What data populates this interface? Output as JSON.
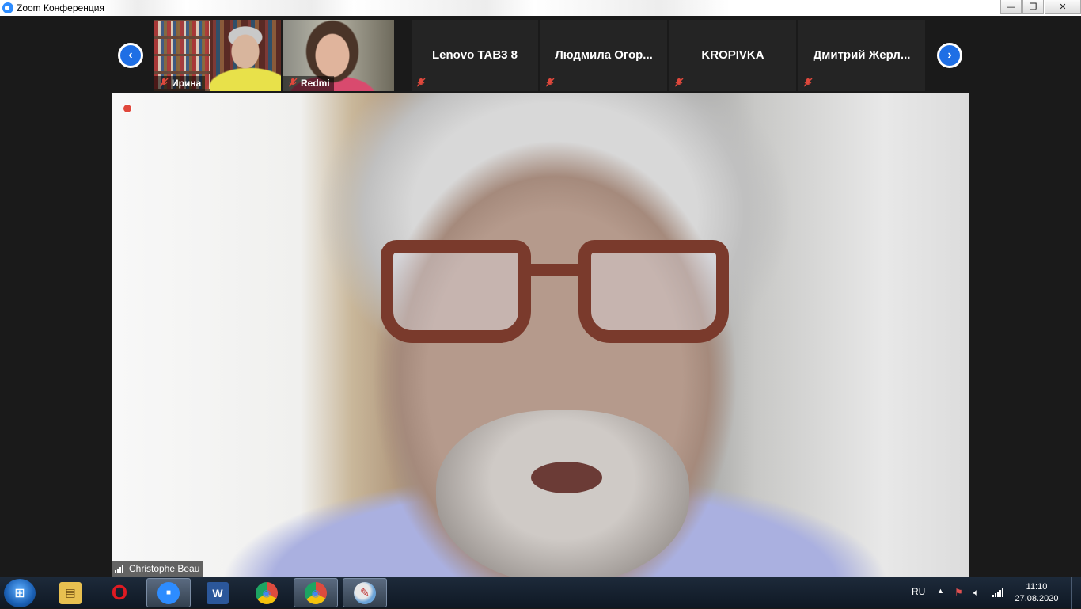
{
  "window": {
    "title": "Zoom Конференция",
    "minimize": "—",
    "maximize": "❐",
    "close": "✕"
  },
  "strip": {
    "prev_arrow": "‹",
    "next_arrow": "›",
    "participants": [
      {
        "name": "Ирина",
        "video": true,
        "muted": true
      },
      {
        "name": "Redmi",
        "video": true,
        "muted": true
      },
      {
        "name": "Lenovo TAB3 8",
        "video": false,
        "muted": true
      },
      {
        "name": "Людмила  Огор...",
        "video": false,
        "muted": true
      },
      {
        "name": "KROPIVKA",
        "video": false,
        "muted": true
      },
      {
        "name": "Дмитрий  Жерл...",
        "video": false,
        "muted": true
      }
    ]
  },
  "main": {
    "speaker": "Christophe Beau",
    "recording_indicator": true
  },
  "taskbar": {
    "start": "⊞",
    "apps": [
      {
        "name": "file-explorer",
        "glyph": "▤",
        "color": "#e8c050",
        "active": false
      },
      {
        "name": "opera",
        "glyph": "O",
        "color": "#e01a22",
        "active": false
      },
      {
        "name": "zoom",
        "glyph": "■",
        "color": "#2d8cff",
        "active": true
      },
      {
        "name": "word",
        "glyph": "W",
        "color": "#2b579a",
        "active": false
      },
      {
        "name": "chrome",
        "glyph": "◉",
        "color": "#dd4b3e",
        "active": false
      },
      {
        "name": "chrome-2",
        "glyph": "◉",
        "color": "#dd4b3e",
        "active": true
      },
      {
        "name": "paint",
        "glyph": "✎",
        "color": "#6aa3d8",
        "active": true
      }
    ],
    "language": "RU",
    "time": "11:10",
    "date": "27.08.2020"
  }
}
